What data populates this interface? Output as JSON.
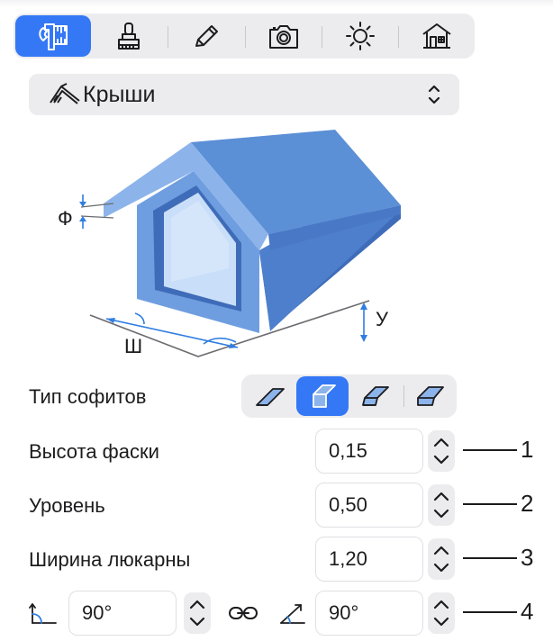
{
  "toolbar": {
    "tools": [
      {
        "name": "measure",
        "icon": "measure-ruler-icon",
        "active": true
      },
      {
        "name": "materials",
        "icon": "brush-stamp-icon",
        "active": false
      },
      {
        "name": "edit",
        "icon": "pencil-icon",
        "active": false
      },
      {
        "name": "camera",
        "icon": "camera-icon",
        "active": false
      },
      {
        "name": "lighting",
        "icon": "sun-icon",
        "active": false
      },
      {
        "name": "building",
        "icon": "house-icon",
        "active": false
      }
    ]
  },
  "dropdown": {
    "icon": "roof-icon",
    "label": "Крыши"
  },
  "illustration": {
    "labels": {
      "fascia": "Ф",
      "width": "Ш",
      "level": "У"
    }
  },
  "soffit": {
    "label": "Тип софитов",
    "options": [
      "soffit-flat",
      "soffit-vertical",
      "soffit-angled",
      "soffit-horizontal"
    ],
    "selected_index": 1
  },
  "fields": {
    "fascia_height": {
      "label": "Высота фаски",
      "value": "0,15",
      "callout": "1"
    },
    "level": {
      "label": "Уровень",
      "value": "0,50",
      "callout": "2"
    },
    "dormer_width": {
      "label": "Ширина люкарны",
      "value": "1,20",
      "callout": "3"
    }
  },
  "angles": {
    "left_value": "90°",
    "right_value": "90°",
    "callout": "4",
    "left_icon": "angle-left-icon",
    "right_icon": "angle-right-icon",
    "link_icon": "link-chain-icon"
  },
  "colors": {
    "accent": "#3478f6",
    "control_bg": "#ececee",
    "roof": "#5b8fd6",
    "roof_light": "#8cb4ea",
    "wall": "#6f9ee0",
    "wall_dark": "#3f6cb9",
    "glass": "#c9def8",
    "dimension": "#2f7de1"
  }
}
